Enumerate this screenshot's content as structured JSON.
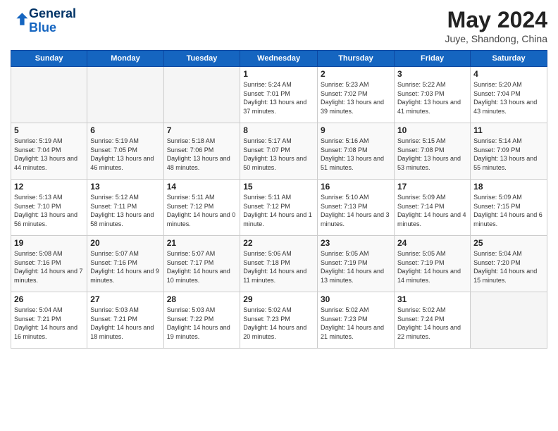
{
  "header": {
    "logo_line1": "General",
    "logo_line2": "Blue",
    "month_year": "May 2024",
    "location": "Juye, Shandong, China"
  },
  "weekdays": [
    "Sunday",
    "Monday",
    "Tuesday",
    "Wednesday",
    "Thursday",
    "Friday",
    "Saturday"
  ],
  "weeks": [
    [
      {
        "day": "",
        "info": ""
      },
      {
        "day": "",
        "info": ""
      },
      {
        "day": "",
        "info": ""
      },
      {
        "day": "1",
        "info": "Sunrise: 5:24 AM\nSunset: 7:01 PM\nDaylight: 13 hours and 37 minutes."
      },
      {
        "day": "2",
        "info": "Sunrise: 5:23 AM\nSunset: 7:02 PM\nDaylight: 13 hours and 39 minutes."
      },
      {
        "day": "3",
        "info": "Sunrise: 5:22 AM\nSunset: 7:03 PM\nDaylight: 13 hours and 41 minutes."
      },
      {
        "day": "4",
        "info": "Sunrise: 5:20 AM\nSunset: 7:04 PM\nDaylight: 13 hours and 43 minutes."
      }
    ],
    [
      {
        "day": "5",
        "info": "Sunrise: 5:19 AM\nSunset: 7:04 PM\nDaylight: 13 hours and 44 minutes."
      },
      {
        "day": "6",
        "info": "Sunrise: 5:19 AM\nSunset: 7:05 PM\nDaylight: 13 hours and 46 minutes."
      },
      {
        "day": "7",
        "info": "Sunrise: 5:18 AM\nSunset: 7:06 PM\nDaylight: 13 hours and 48 minutes."
      },
      {
        "day": "8",
        "info": "Sunrise: 5:17 AM\nSunset: 7:07 PM\nDaylight: 13 hours and 50 minutes."
      },
      {
        "day": "9",
        "info": "Sunrise: 5:16 AM\nSunset: 7:08 PM\nDaylight: 13 hours and 51 minutes."
      },
      {
        "day": "10",
        "info": "Sunrise: 5:15 AM\nSunset: 7:08 PM\nDaylight: 13 hours and 53 minutes."
      },
      {
        "day": "11",
        "info": "Sunrise: 5:14 AM\nSunset: 7:09 PM\nDaylight: 13 hours and 55 minutes."
      }
    ],
    [
      {
        "day": "12",
        "info": "Sunrise: 5:13 AM\nSunset: 7:10 PM\nDaylight: 13 hours and 56 minutes."
      },
      {
        "day": "13",
        "info": "Sunrise: 5:12 AM\nSunset: 7:11 PM\nDaylight: 13 hours and 58 minutes."
      },
      {
        "day": "14",
        "info": "Sunrise: 5:11 AM\nSunset: 7:12 PM\nDaylight: 14 hours and 0 minutes."
      },
      {
        "day": "15",
        "info": "Sunrise: 5:11 AM\nSunset: 7:12 PM\nDaylight: 14 hours and 1 minute."
      },
      {
        "day": "16",
        "info": "Sunrise: 5:10 AM\nSunset: 7:13 PM\nDaylight: 14 hours and 3 minutes."
      },
      {
        "day": "17",
        "info": "Sunrise: 5:09 AM\nSunset: 7:14 PM\nDaylight: 14 hours and 4 minutes."
      },
      {
        "day": "18",
        "info": "Sunrise: 5:09 AM\nSunset: 7:15 PM\nDaylight: 14 hours and 6 minutes."
      }
    ],
    [
      {
        "day": "19",
        "info": "Sunrise: 5:08 AM\nSunset: 7:16 PM\nDaylight: 14 hours and 7 minutes."
      },
      {
        "day": "20",
        "info": "Sunrise: 5:07 AM\nSunset: 7:16 PM\nDaylight: 14 hours and 9 minutes."
      },
      {
        "day": "21",
        "info": "Sunrise: 5:07 AM\nSunset: 7:17 PM\nDaylight: 14 hours and 10 minutes."
      },
      {
        "day": "22",
        "info": "Sunrise: 5:06 AM\nSunset: 7:18 PM\nDaylight: 14 hours and 11 minutes."
      },
      {
        "day": "23",
        "info": "Sunrise: 5:05 AM\nSunset: 7:19 PM\nDaylight: 14 hours and 13 minutes."
      },
      {
        "day": "24",
        "info": "Sunrise: 5:05 AM\nSunset: 7:19 PM\nDaylight: 14 hours and 14 minutes."
      },
      {
        "day": "25",
        "info": "Sunrise: 5:04 AM\nSunset: 7:20 PM\nDaylight: 14 hours and 15 minutes."
      }
    ],
    [
      {
        "day": "26",
        "info": "Sunrise: 5:04 AM\nSunset: 7:21 PM\nDaylight: 14 hours and 16 minutes."
      },
      {
        "day": "27",
        "info": "Sunrise: 5:03 AM\nSunset: 7:21 PM\nDaylight: 14 hours and 18 minutes."
      },
      {
        "day": "28",
        "info": "Sunrise: 5:03 AM\nSunset: 7:22 PM\nDaylight: 14 hours and 19 minutes."
      },
      {
        "day": "29",
        "info": "Sunrise: 5:02 AM\nSunset: 7:23 PM\nDaylight: 14 hours and 20 minutes."
      },
      {
        "day": "30",
        "info": "Sunrise: 5:02 AM\nSunset: 7:23 PM\nDaylight: 14 hours and 21 minutes."
      },
      {
        "day": "31",
        "info": "Sunrise: 5:02 AM\nSunset: 7:24 PM\nDaylight: 14 hours and 22 minutes."
      },
      {
        "day": "",
        "info": ""
      }
    ]
  ]
}
